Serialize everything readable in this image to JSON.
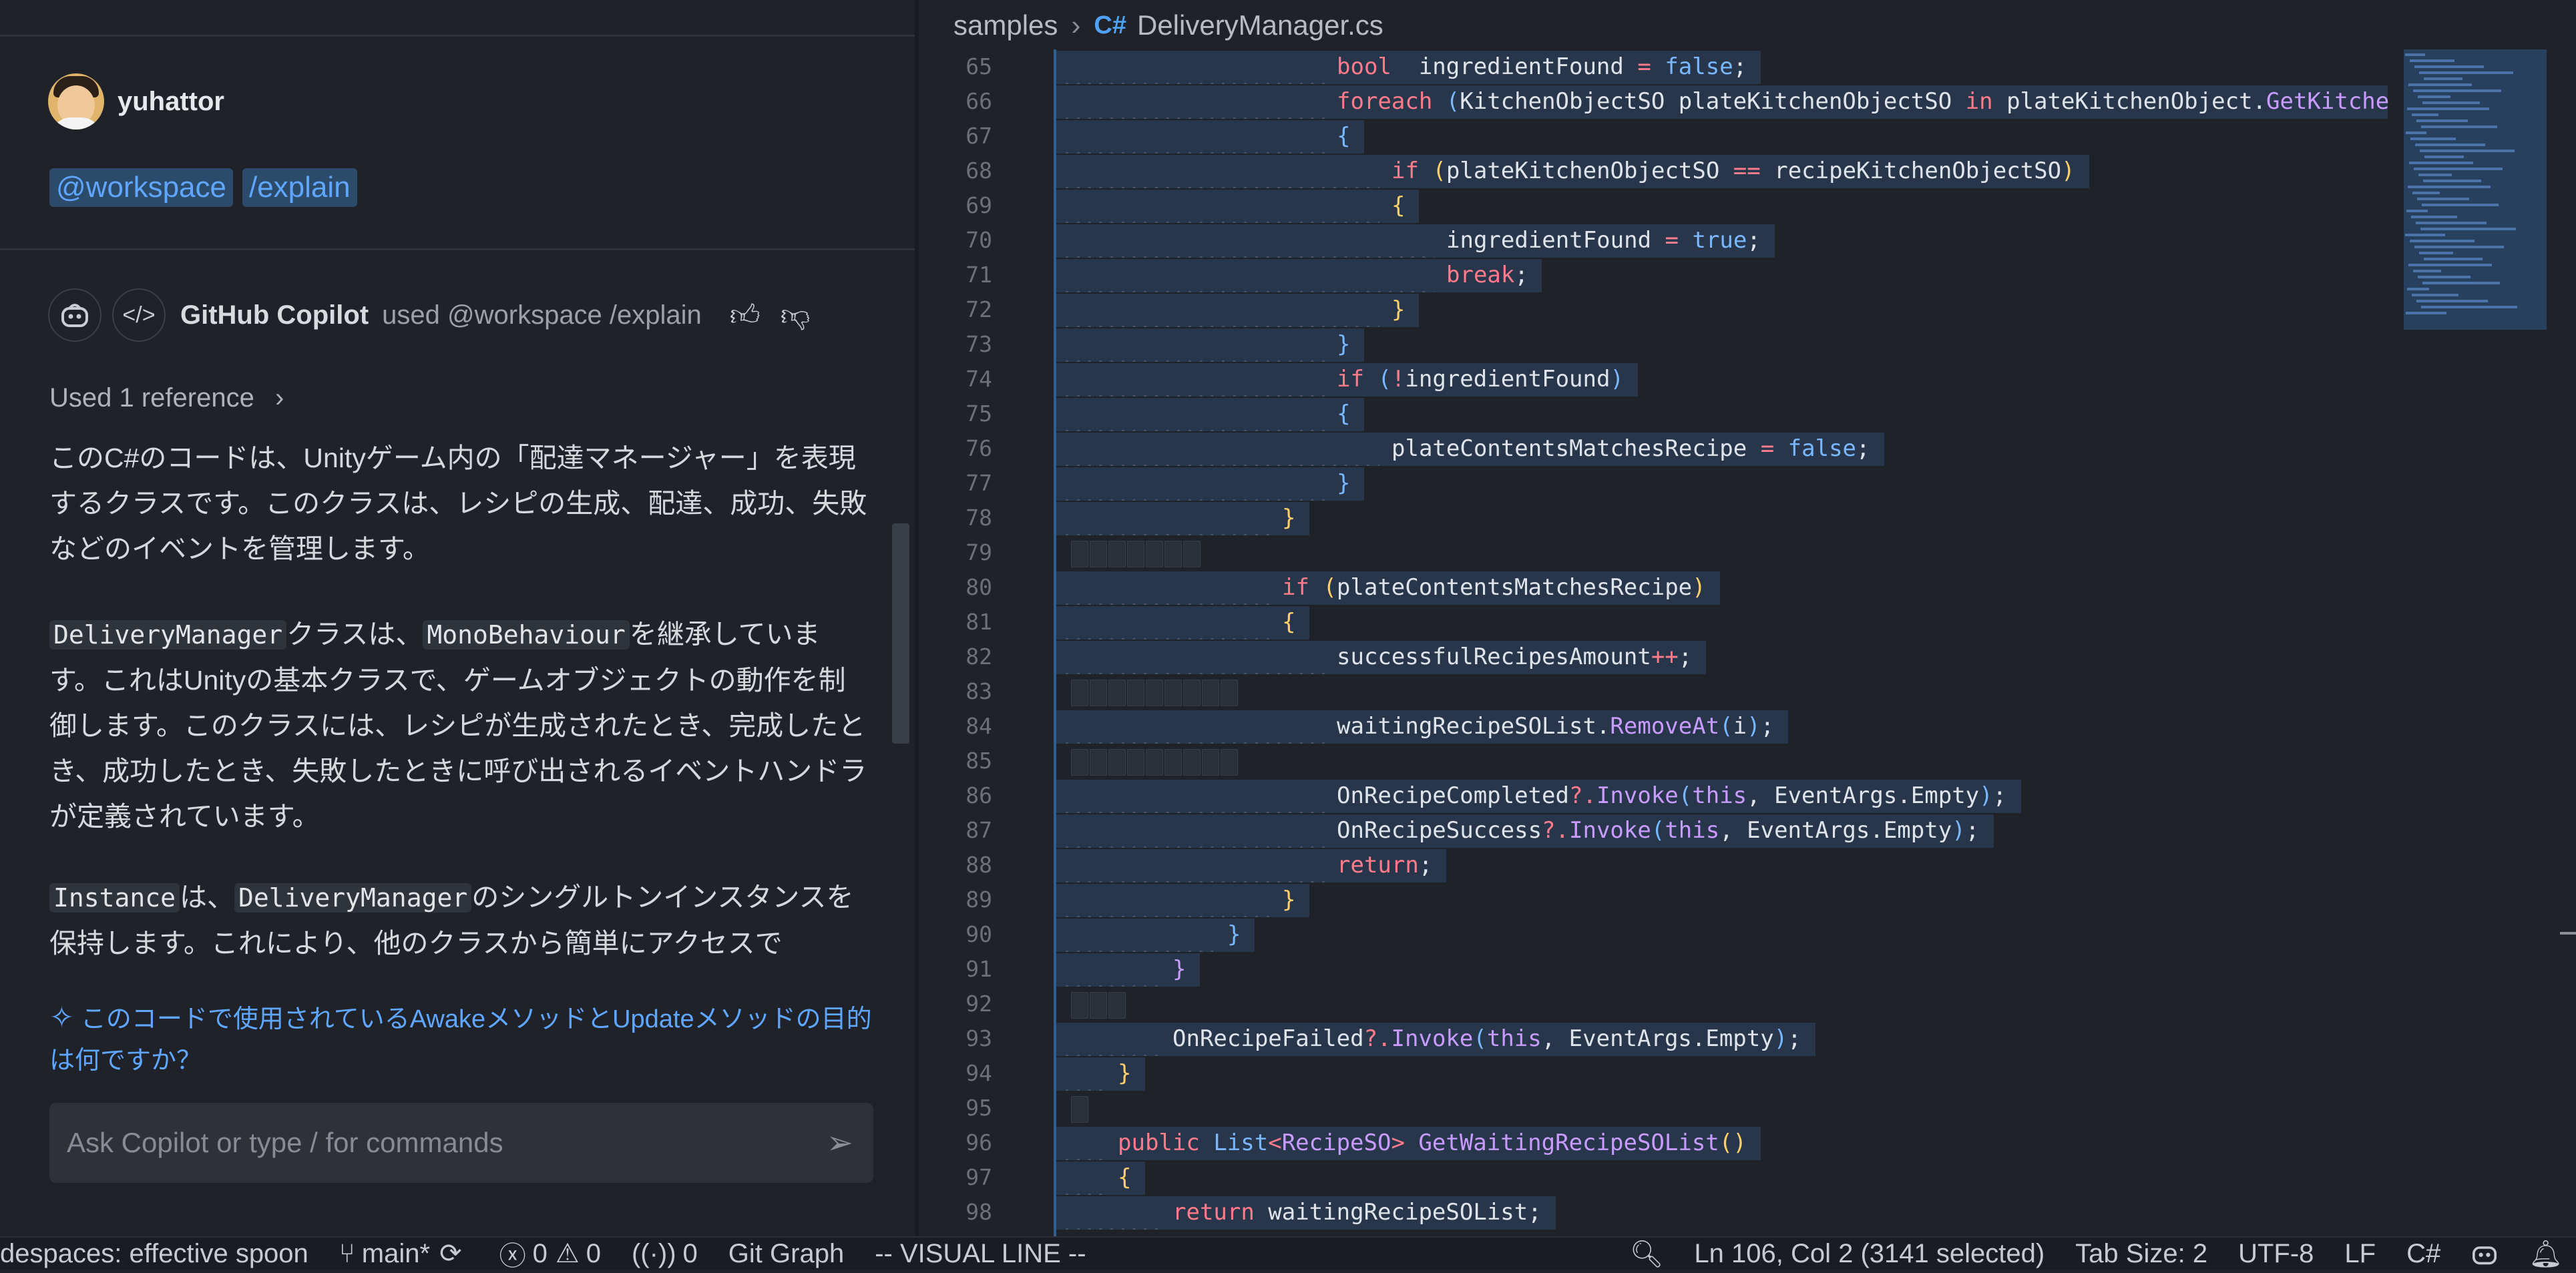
{
  "chat": {
    "user": {
      "name": "yuhattor"
    },
    "tags": [
      "@workspace",
      "/explain"
    ],
    "response_header": {
      "name": "GitHub Copilot",
      "used": "used @workspace /explain"
    },
    "used_reference": "Used 1 reference",
    "paragraphs": {
      "p1": "このC#のコードは、Unityゲーム内の「配達マネージャー」を表現するクラスです。このクラスは、レシピの生成、配達、成功、失敗などのイベントを管理します。",
      "p2_code1": "DeliveryManager",
      "p2_t1": "クラスは、",
      "p2_code2": "MonoBehaviour",
      "p2_t2": "を継承しています。これはUnityの基本クラスで、ゲームオブジェクトの動作を制御します。このクラスには、レシピが生成されたとき、完成したとき、成功したとき、失敗したときに呼び出されるイベントハンドラが定義されています。",
      "p3_code1": "Instance",
      "p3_t1": "は、",
      "p3_code2": "DeliveryManager",
      "p3_t2": "のシングルトンインスタンスを保持します。これにより、他のクラスから簡単にアクセスで"
    },
    "suggestion": "このコードで使用されているAwakeメソッドとUpdateメソッドの目的は何ですか？",
    "input_placeholder": "Ask Copilot or type / for commands"
  },
  "editor": {
    "breadcrumb": [
      "samples",
      "DeliveryManager.cs"
    ],
    "file_icon": "C#",
    "lines": [
      {
        "n": "65",
        "indent": 10,
        "parts": [
          [
            "kw",
            "bool"
          ],
          [
            "",
            "  ingredientFound "
          ],
          [
            "op",
            "="
          ],
          [
            "",
            " "
          ],
          [
            "bool",
            "false"
          ],
          [
            "",
            ";"
          ]
        ]
      },
      {
        "n": "66",
        "indent": 10,
        "parts": [
          [
            "kw",
            "foreach"
          ],
          [
            "",
            " "
          ],
          [
            "br2",
            "("
          ],
          [
            "",
            "KitchenObjectSO plateKitchenObjectSO "
          ],
          [
            "kw",
            "in"
          ],
          [
            "",
            " plateKitchenObject."
          ],
          [
            "fn",
            "GetKitche"
          ]
        ]
      },
      {
        "n": "67",
        "indent": 10,
        "parts": [
          [
            "br2",
            "{"
          ]
        ]
      },
      {
        "n": "68",
        "indent": 12,
        "parts": [
          [
            "kw",
            "if"
          ],
          [
            "",
            " "
          ],
          [
            "br",
            "("
          ],
          [
            "",
            "plateKitchenObjectSO "
          ],
          [
            "op",
            "=="
          ],
          [
            "",
            " recipeKitchenObjectSO"
          ],
          [
            "br",
            ")"
          ]
        ]
      },
      {
        "n": "69",
        "indent": 12,
        "parts": [
          [
            "br",
            "{"
          ]
        ]
      },
      {
        "n": "70",
        "indent": 14,
        "parts": [
          [
            "",
            "ingredientFound "
          ],
          [
            "op",
            "="
          ],
          [
            "",
            " "
          ],
          [
            "bool",
            "true"
          ],
          [
            "",
            ";"
          ]
        ]
      },
      {
        "n": "71",
        "indent": 14,
        "parts": [
          [
            "kw",
            "break"
          ],
          [
            "",
            ";"
          ]
        ]
      },
      {
        "n": "72",
        "indent": 12,
        "parts": [
          [
            "br",
            "}"
          ]
        ]
      },
      {
        "n": "73",
        "indent": 10,
        "parts": [
          [
            "br2",
            "}"
          ]
        ]
      },
      {
        "n": "74",
        "indent": 10,
        "parts": [
          [
            "kw",
            "if"
          ],
          [
            "",
            " "
          ],
          [
            "br2",
            "("
          ],
          [
            "op",
            "!"
          ],
          [
            "",
            "ingredientFound"
          ],
          [
            "br2",
            ")"
          ]
        ]
      },
      {
        "n": "75",
        "indent": 10,
        "parts": [
          [
            "br2",
            "{"
          ]
        ]
      },
      {
        "n": "76",
        "indent": 12,
        "parts": [
          [
            "",
            "plateContentsMatchesRecipe "
          ],
          [
            "op",
            "="
          ],
          [
            "",
            " "
          ],
          [
            "bool",
            "false"
          ],
          [
            "",
            ";"
          ]
        ]
      },
      {
        "n": "77",
        "indent": 10,
        "parts": [
          [
            "br2",
            "}"
          ]
        ]
      },
      {
        "n": "78",
        "indent": 8,
        "parts": [
          [
            "br",
            "}"
          ]
        ]
      },
      {
        "n": "79",
        "indent": 0,
        "blank": 7,
        "parts": []
      },
      {
        "n": "80",
        "indent": 8,
        "parts": [
          [
            "kw",
            "if"
          ],
          [
            "",
            " "
          ],
          [
            "br",
            "("
          ],
          [
            "",
            "plateContentsMatchesRecipe"
          ],
          [
            "br",
            ")"
          ]
        ]
      },
      {
        "n": "81",
        "indent": 8,
        "parts": [
          [
            "br",
            "{"
          ]
        ]
      },
      {
        "n": "82",
        "indent": 10,
        "parts": [
          [
            "",
            "successfulRecipesAmount"
          ],
          [
            "op",
            "++"
          ],
          [
            "",
            ";"
          ]
        ]
      },
      {
        "n": "83",
        "indent": 0,
        "blank": 9,
        "parts": []
      },
      {
        "n": "84",
        "indent": 10,
        "parts": [
          [
            "",
            "waitingRecipeSOList."
          ],
          [
            "fn",
            "RemoveAt"
          ],
          [
            "br2",
            "("
          ],
          [
            "",
            "i"
          ],
          [
            "br2",
            ")"
          ],
          [
            "",
            ";"
          ]
        ]
      },
      {
        "n": "85",
        "indent": 0,
        "blank": 9,
        "parts": []
      },
      {
        "n": "86",
        "indent": 10,
        "parts": [
          [
            "",
            "OnRecipeCompleted"
          ],
          [
            "op",
            "?."
          ],
          [
            "fn",
            "Invoke"
          ],
          [
            "br2",
            "("
          ],
          [
            "kw2",
            "this"
          ],
          [
            "",
            ", EventArgs.Empty"
          ],
          [
            "br2",
            ")"
          ],
          [
            "",
            ";"
          ]
        ]
      },
      {
        "n": "87",
        "indent": 10,
        "parts": [
          [
            "",
            "OnRecipeSuccess"
          ],
          [
            "op",
            "?."
          ],
          [
            "fn",
            "Invoke"
          ],
          [
            "br2",
            "("
          ],
          [
            "kw2",
            "this"
          ],
          [
            "",
            ", EventArgs.Empty"
          ],
          [
            "br2",
            ")"
          ],
          [
            "",
            ";"
          ]
        ]
      },
      {
        "n": "88",
        "indent": 10,
        "parts": [
          [
            "kw",
            "return"
          ],
          [
            "",
            ";"
          ]
        ]
      },
      {
        "n": "89",
        "indent": 8,
        "parts": [
          [
            "br",
            "}"
          ]
        ]
      },
      {
        "n": "90",
        "indent": 6,
        "parts": [
          [
            "br2",
            "}"
          ]
        ]
      },
      {
        "n": "91",
        "indent": 4,
        "parts": [
          [
            "fn",
            "}"
          ]
        ]
      },
      {
        "n": "92",
        "indent": 0,
        "blank": 3,
        "parts": []
      },
      {
        "n": "93",
        "indent": 4,
        "parts": [
          [
            "",
            "OnRecipeFailed"
          ],
          [
            "op",
            "?."
          ],
          [
            "fn",
            "Invoke"
          ],
          [
            "br2",
            "("
          ],
          [
            "kw2",
            "this"
          ],
          [
            "",
            ", EventArgs.Empty"
          ],
          [
            "br2",
            ")"
          ],
          [
            "",
            ";"
          ]
        ]
      },
      {
        "n": "94",
        "indent": 2,
        "parts": [
          [
            "br",
            "}"
          ]
        ]
      },
      {
        "n": "95",
        "indent": 0,
        "blank": 1,
        "parts": []
      },
      {
        "n": "96",
        "indent": 2,
        "parts": [
          [
            "kw",
            "public"
          ],
          [
            "",
            " "
          ],
          [
            "br2",
            "List"
          ],
          [
            "op",
            "<"
          ],
          [
            "fn",
            "RecipeSO"
          ],
          [
            "op",
            ">"
          ],
          [
            "",
            " "
          ],
          [
            "fn",
            "GetWaitingRecipeSOList"
          ],
          [
            "br",
            "()"
          ]
        ]
      },
      {
        "n": "97",
        "indent": 2,
        "parts": [
          [
            "br",
            "{"
          ]
        ]
      },
      {
        "n": "98",
        "indent": 4,
        "parts": [
          [
            "kw",
            "return"
          ],
          [
            "",
            " waitingRecipeSOList;"
          ]
        ]
      }
    ]
  },
  "status": {
    "codespace": "despaces: effective spoon",
    "branch": "main*",
    "errors": "0",
    "warnings": "0",
    "ports": "0",
    "git_graph": "Git Graph",
    "mode": "-- VISUAL LINE --",
    "position": "Ln 106, Col 2 (3141 selected)",
    "tab_size": "Tab Size: 2",
    "encoding": "UTF-8",
    "eol": "LF",
    "language": "C#"
  }
}
